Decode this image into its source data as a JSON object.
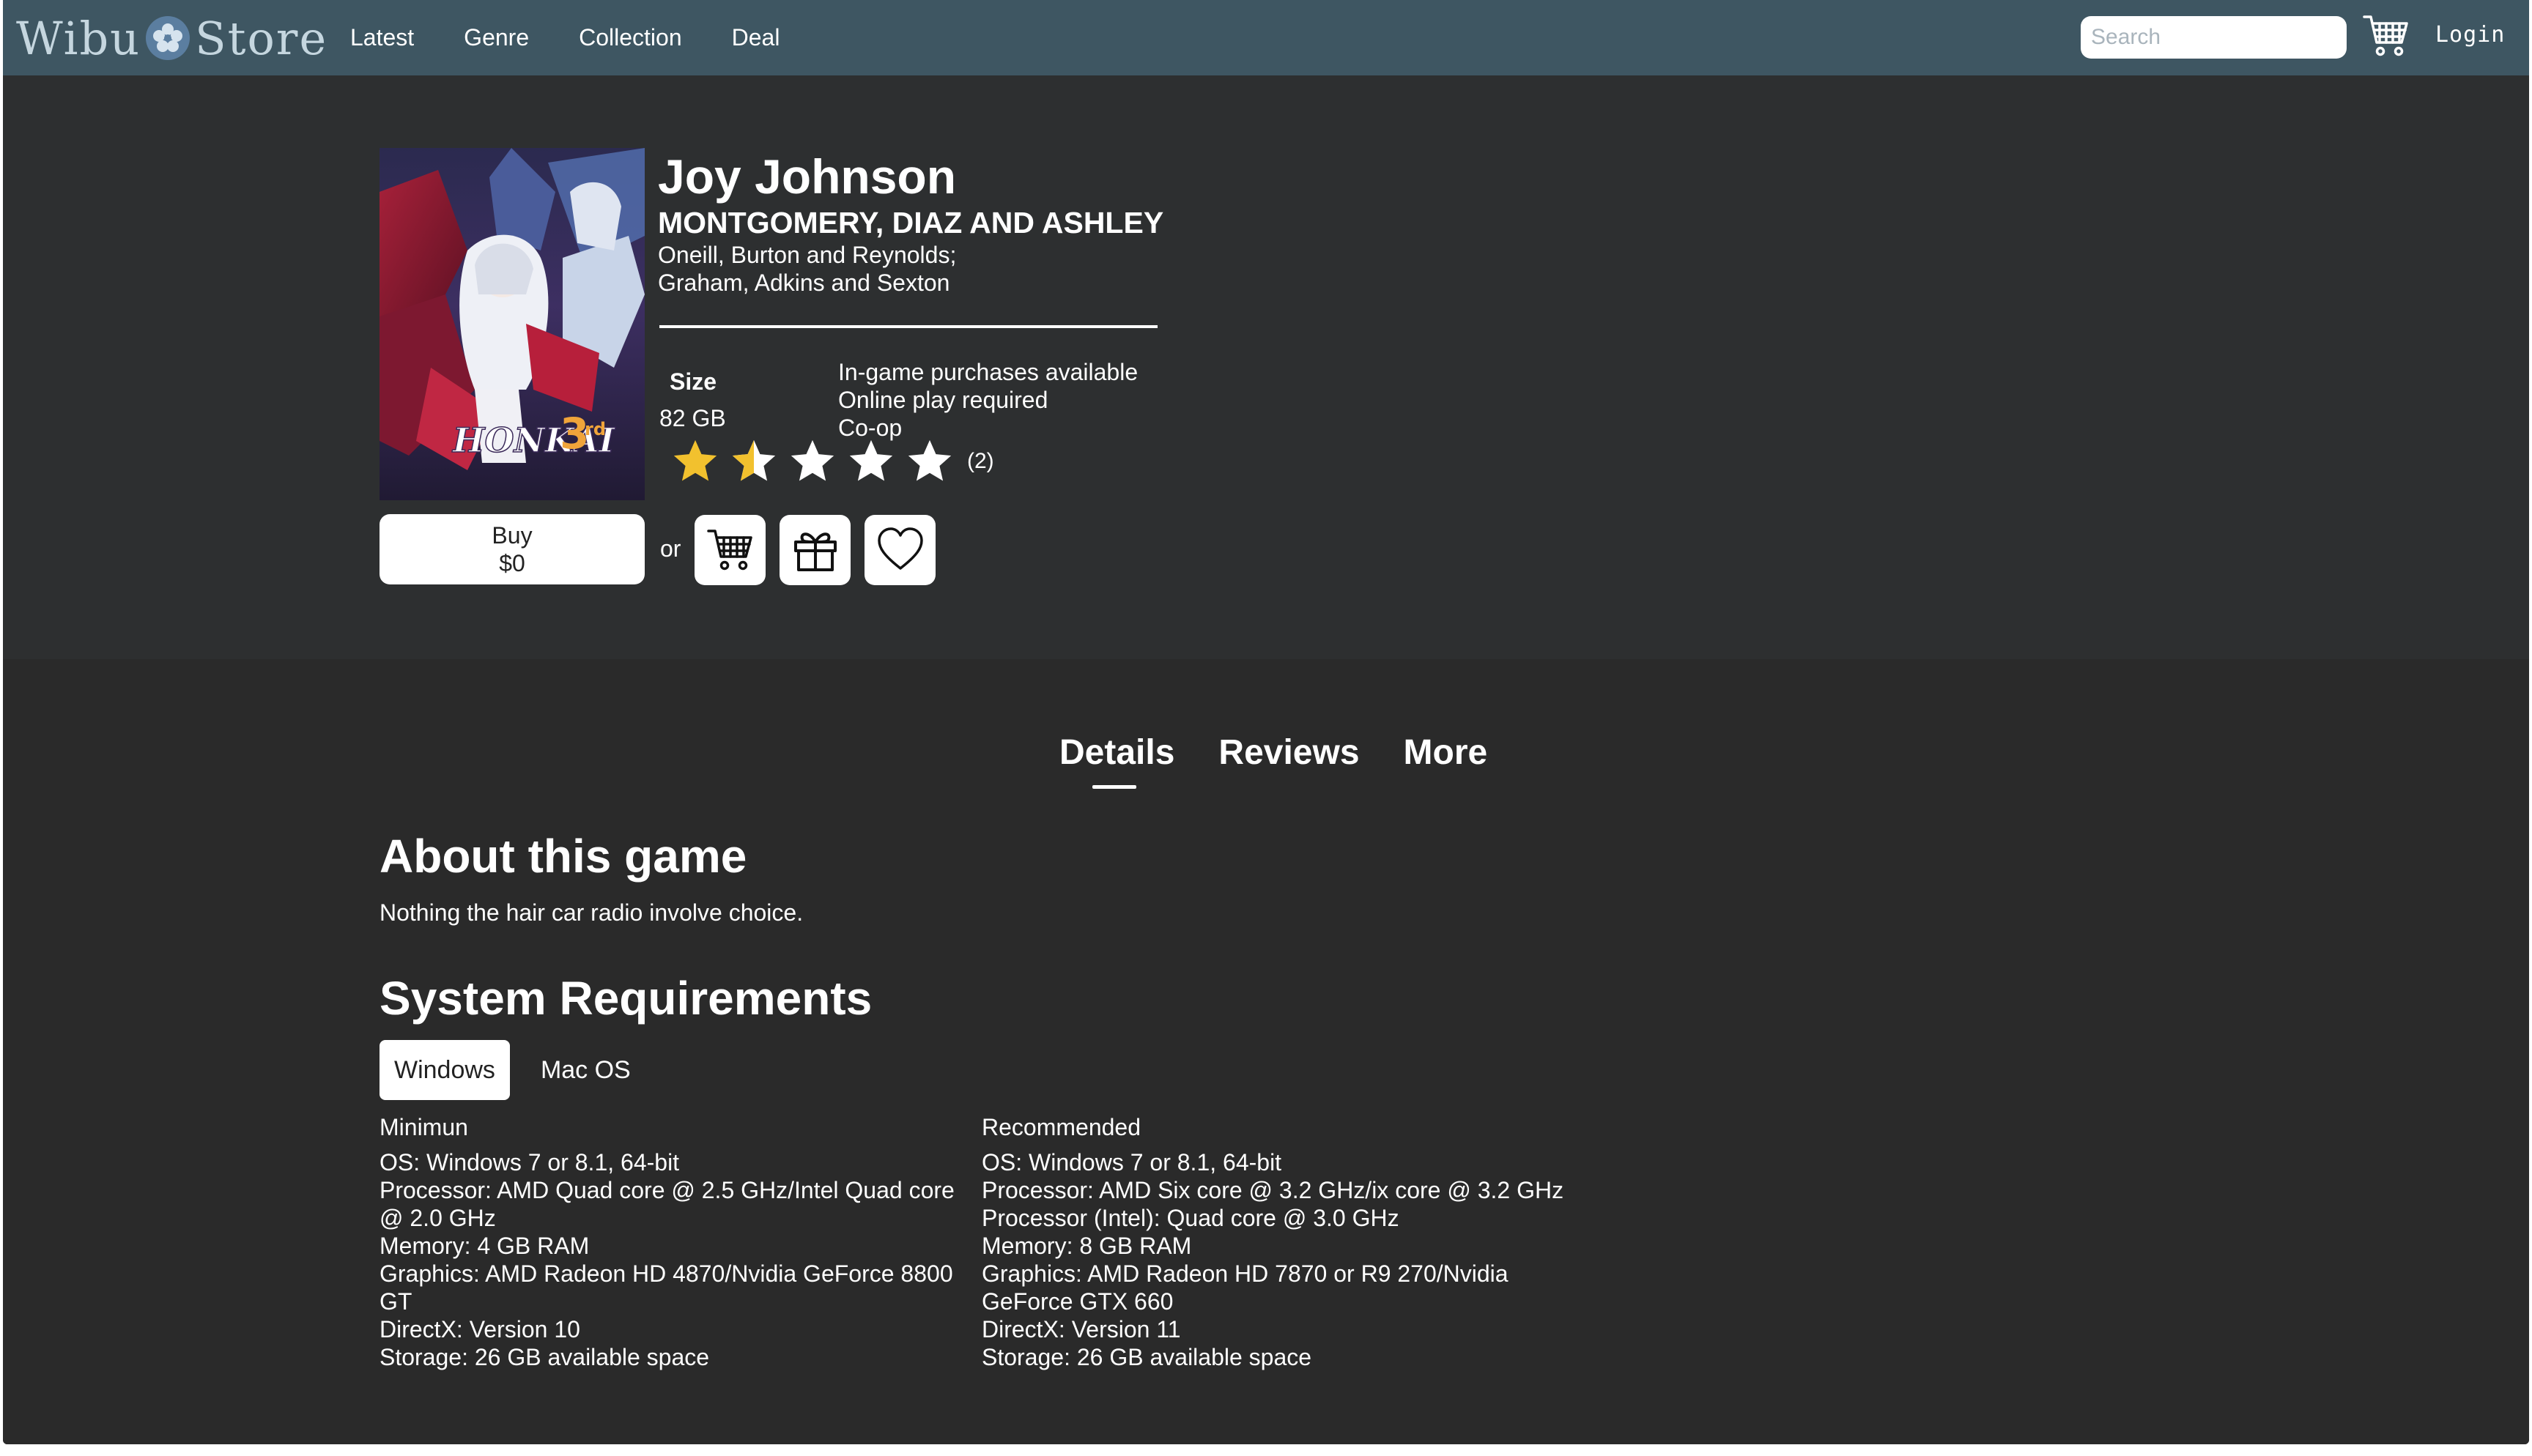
{
  "header": {
    "logo_left": "Wibu",
    "logo_right": "Store",
    "nav": [
      "Latest",
      "Genre",
      "Collection",
      "Deal"
    ],
    "search_placeholder": "Search",
    "login_label": "Login"
  },
  "game": {
    "title": "Joy Johnson",
    "developer": "MONTGOMERY, DIAZ AND ASHLEY",
    "publishers": [
      "Oneill, Burton and Reynolds;",
      "Graham, Adkins and Sexton"
    ],
    "cover_art_text": "HONKAI 3rd",
    "size_label": "Size",
    "size_value": "82 GB",
    "features": [
      "In-game purchases available",
      "Online play required",
      "Co-op"
    ],
    "rating": {
      "value": 1.5,
      "max": 5,
      "count_label": "(2)"
    },
    "buy_label": "Buy",
    "price": "$0",
    "or_label": "or"
  },
  "tabs": [
    "Details",
    "Reviews",
    "More"
  ],
  "active_tab": "Details",
  "about": {
    "heading": "About this game",
    "text": "Nothing the hair car radio involve choice."
  },
  "system_requirements": {
    "heading": "System Requirements",
    "os_tabs": [
      "Windows",
      "Mac OS"
    ],
    "active_os": "Windows",
    "minimum": {
      "heading": "Minimun",
      "lines": [
        "OS: Windows 7 or 8.1, 64-bit",
        "Processor: AMD Quad core @ 2.5 GHz/Intel Quad core @ 2.0 GHz",
        "Memory: 4 GB RAM",
        "Graphics: AMD Radeon HD 4870/Nvidia GeForce 8800 GT",
        "DirectX: Version 10",
        "Storage: 26 GB available space"
      ]
    },
    "recommended": {
      "heading": "Recommended",
      "lines": [
        "OS: Windows 7 or 8.1, 64-bit",
        "Processor: AMD Six core @ 3.2 GHz/ix core @ 3.2 GHz",
        "Processor (Intel): Quad core @ 3.0 GHz",
        "Memory: 8 GB RAM",
        "Graphics: AMD Radeon HD 7870 or R9 270/Nvidia GeForce GTX 660",
        "DirectX: Version 11",
        "Storage: 26 GB available space"
      ]
    }
  },
  "colors": {
    "topbar": "#3e5662",
    "background": "#2d2f30",
    "lower_background": "#2a2a2a",
    "star_filled": "#f2c12e",
    "star_empty": "#ffffff"
  },
  "icons": [
    "flower-logo-icon",
    "cart-icon",
    "star-icon",
    "gift-icon",
    "heart-icon"
  ]
}
